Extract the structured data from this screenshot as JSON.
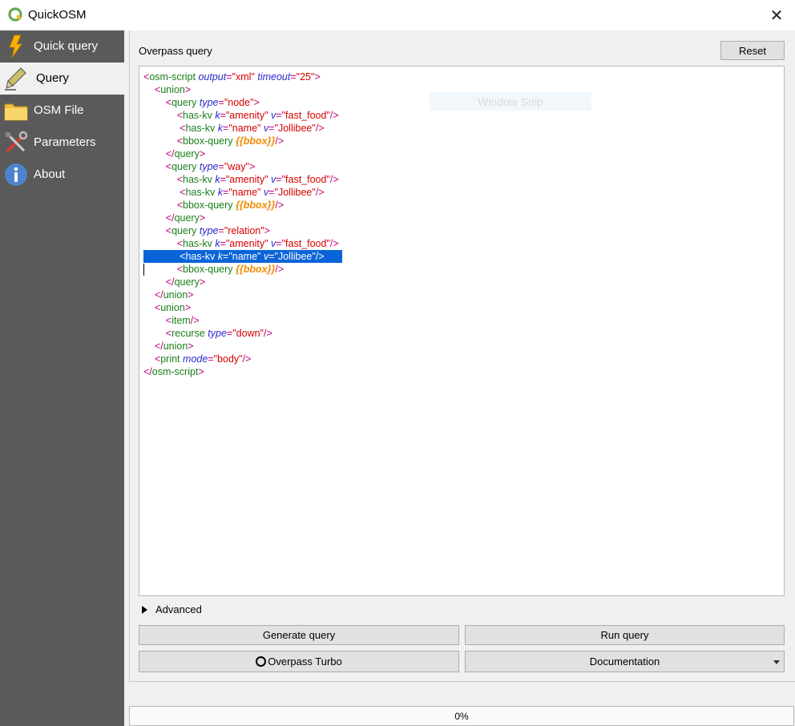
{
  "window": {
    "title": "QuickOSM",
    "close_label": "✕"
  },
  "sidebar": {
    "items": [
      {
        "label": "Quick query",
        "icon": "lightning-icon"
      },
      {
        "label": "Query",
        "icon": "pencil-icon"
      },
      {
        "label": "OSM File",
        "icon": "folder-icon"
      },
      {
        "label": "Parameters",
        "icon": "tools-icon"
      },
      {
        "label": "About",
        "icon": "info-icon"
      }
    ],
    "active": "Query"
  },
  "panel": {
    "title": "Overpass query",
    "reset_label": "Reset"
  },
  "editor": {
    "lines": [
      "<osm-script output=\"xml\" timeout=\"25\">",
      "    <union>",
      "        <query type=\"node\">",
      "            <has-kv k=\"amenity\" v=\"fast_food\"/>",
      "             <has-kv k=\"name\" v=\"Jollibee\"/>",
      "            <bbox-query {{bbox}}/>",
      "        </query>",
      "        <query type=\"way\">",
      "            <has-kv k=\"amenity\" v=\"fast_food\"/>",
      "             <has-kv k=\"name\" v=\"Jollibee\"/>",
      "            <bbox-query {{bbox}}/>",
      "        </query>",
      "        <query type=\"relation\">",
      "            <has-kv k=\"amenity\" v=\"fast_food\"/>",
      "             <has-kv k=\"name\" v=\"Jollibee\"/>",
      "            <bbox-query {{bbox}}/>",
      "        </query>",
      "    </union>",
      "    <union>",
      "        <item/>",
      "        <recurse type=\"down\"/>",
      "    </union>",
      "    <print mode=\"body\"/>",
      "</osm-script>"
    ],
    "selected_line": 14,
    "overlay_text": "Window Snip"
  },
  "advanced": {
    "label": "Advanced"
  },
  "buttons": {
    "generate": "Generate query",
    "run": "Run query",
    "overpass_turbo": "Overpass Turbo",
    "documentation": "Documentation"
  },
  "progress": {
    "value": 0,
    "label": "0%"
  }
}
